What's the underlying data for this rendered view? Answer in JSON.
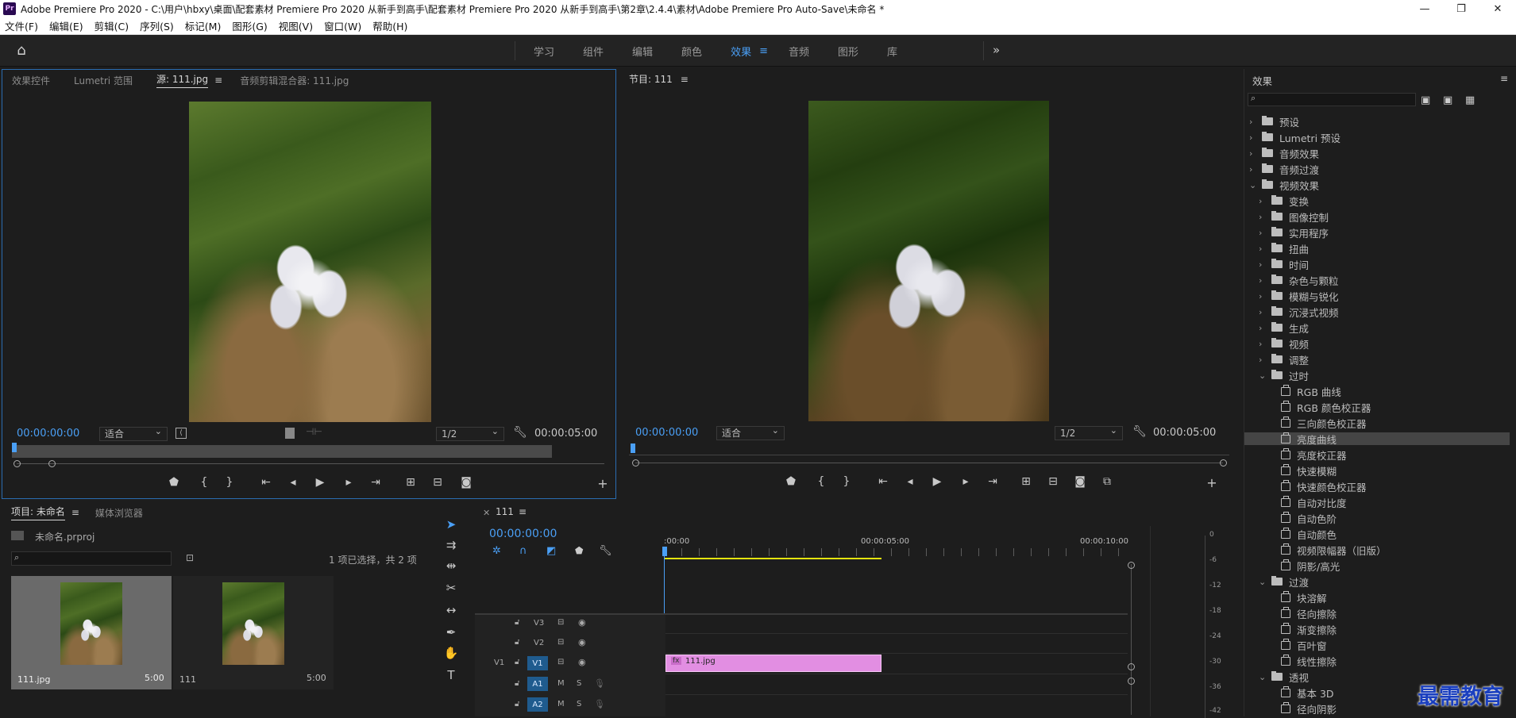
{
  "window": {
    "title": "Adobe Premiere Pro 2020 - C:\\用户\\hbxy\\桌面\\配套素材 Premiere Pro 2020 从新手到高手\\配套素材 Premiere Pro 2020 从新手到高手\\第2章\\2.4.4\\素材\\Adobe Premiere Pro Auto-Save\\未命名 *",
    "logo": "Pr",
    "minimize": "—",
    "restore": "❐",
    "close": "✕"
  },
  "menu": [
    "文件(F)",
    "编辑(E)",
    "剪辑(C)",
    "序列(S)",
    "标记(M)",
    "图形(G)",
    "视图(V)",
    "窗口(W)",
    "帮助(H)"
  ],
  "workspace": {
    "tabs": [
      "学习",
      "组件",
      "编辑",
      "颜色",
      "效果",
      "音频",
      "图形",
      "库"
    ],
    "active": "效果",
    "more": "»"
  },
  "source_panel": {
    "tabs": [
      "效果控件",
      "Lumetri 范围",
      "源: 111.jpg",
      "音频剪辑混合器: 111.jpg"
    ],
    "active_tab": "源: 111.jpg",
    "timecode": "00:00:00:00",
    "fit": "适合",
    "resolution": "1/2",
    "duration": "00:00:05:00"
  },
  "program_panel": {
    "title": "节目: 111",
    "timecode": "00:00:00:00",
    "fit": "适合",
    "resolution": "1/2",
    "duration": "00:00:05:00"
  },
  "effects_panel": {
    "title": "效果",
    "search_placeholder": "",
    "tree": [
      {
        "label": "预设",
        "level": 0,
        "type": "folder-special",
        "expanded": false
      },
      {
        "label": "Lumetri 预设",
        "level": 0,
        "type": "folder-special",
        "expanded": false
      },
      {
        "label": "音频效果",
        "level": 0,
        "type": "folder",
        "expanded": false
      },
      {
        "label": "音频过渡",
        "level": 0,
        "type": "folder",
        "expanded": false
      },
      {
        "label": "视频效果",
        "level": 0,
        "type": "folder",
        "expanded": true
      },
      {
        "label": "变换",
        "level": 1,
        "type": "folder",
        "expanded": false
      },
      {
        "label": "图像控制",
        "level": 1,
        "type": "folder",
        "expanded": false
      },
      {
        "label": "实用程序",
        "level": 1,
        "type": "folder",
        "expanded": false
      },
      {
        "label": "扭曲",
        "level": 1,
        "type": "folder",
        "expanded": false
      },
      {
        "label": "时间",
        "level": 1,
        "type": "folder",
        "expanded": false
      },
      {
        "label": "杂色与颗粒",
        "level": 1,
        "type": "folder",
        "expanded": false
      },
      {
        "label": "模糊与锐化",
        "level": 1,
        "type": "folder",
        "expanded": false
      },
      {
        "label": "沉浸式视频",
        "level": 1,
        "type": "folder",
        "expanded": false
      },
      {
        "label": "生成",
        "level": 1,
        "type": "folder",
        "expanded": false
      },
      {
        "label": "视频",
        "level": 1,
        "type": "folder",
        "expanded": false
      },
      {
        "label": "调整",
        "level": 1,
        "type": "folder",
        "expanded": false
      },
      {
        "label": "过时",
        "level": 1,
        "type": "folder",
        "expanded": true
      },
      {
        "label": "RGB 曲线",
        "level": 2,
        "type": "effect"
      },
      {
        "label": "RGB 颜色校正器",
        "level": 2,
        "type": "effect"
      },
      {
        "label": "三向颜色校正器",
        "level": 2,
        "type": "effect"
      },
      {
        "label": "亮度曲线",
        "level": 2,
        "type": "effect",
        "selected": true
      },
      {
        "label": "亮度校正器",
        "level": 2,
        "type": "effect"
      },
      {
        "label": "快速模糊",
        "level": 2,
        "type": "effect"
      },
      {
        "label": "快速颜色校正器",
        "level": 2,
        "type": "effect"
      },
      {
        "label": "自动对比度",
        "level": 2,
        "type": "effect"
      },
      {
        "label": "自动色阶",
        "level": 2,
        "type": "effect"
      },
      {
        "label": "自动颜色",
        "level": 2,
        "type": "effect"
      },
      {
        "label": "视频限幅器（旧版）",
        "level": 2,
        "type": "effect"
      },
      {
        "label": "阴影/高光",
        "level": 2,
        "type": "effect"
      },
      {
        "label": "过渡",
        "level": 1,
        "type": "folder",
        "expanded": true
      },
      {
        "label": "块溶解",
        "level": 2,
        "type": "effect"
      },
      {
        "label": "径向擦除",
        "level": 2,
        "type": "effect"
      },
      {
        "label": "渐变擦除",
        "level": 2,
        "type": "effect"
      },
      {
        "label": "百叶窗",
        "level": 2,
        "type": "effect"
      },
      {
        "label": "线性擦除",
        "level": 2,
        "type": "effect"
      },
      {
        "label": "透视",
        "level": 1,
        "type": "folder",
        "expanded": true
      },
      {
        "label": "基本 3D",
        "level": 2,
        "type": "effect"
      },
      {
        "label": "径向阴影",
        "level": 2,
        "type": "effect"
      }
    ]
  },
  "project_panel": {
    "tabs": [
      "项目: 未命名",
      "媒体浏览器"
    ],
    "file": "未命名.prproj",
    "selection": "1 项已选择，共 2 项",
    "items": [
      {
        "name": "111.jpg",
        "duration": "5:00",
        "selected": true
      },
      {
        "name": "111",
        "duration": "5:00",
        "selected": false
      }
    ]
  },
  "timeline": {
    "tab": "111",
    "timecode": "00:00:00:00",
    "ruler": [
      ":00:00",
      "00:00:05:00",
      "00:00:10:00"
    ],
    "tracks": [
      {
        "id": "V3",
        "kind": "video"
      },
      {
        "id": "V2",
        "kind": "video"
      },
      {
        "id": "V1",
        "kind": "video",
        "source": "V1"
      },
      {
        "id": "A1",
        "kind": "audio"
      },
      {
        "id": "A2",
        "kind": "audio"
      }
    ],
    "clip": {
      "label": "111.jpg",
      "fx": "fx"
    },
    "meter_ticks": [
      "0",
      "-6",
      "-12",
      "-18",
      "-24",
      "-30",
      "-36",
      "-42"
    ]
  },
  "watermark": "最需教育",
  "colors": {
    "accent": "#4a9ff5",
    "clip": "#e28ee2",
    "track_btn": "#1f5b8e",
    "work_area": "#e4e40e"
  }
}
